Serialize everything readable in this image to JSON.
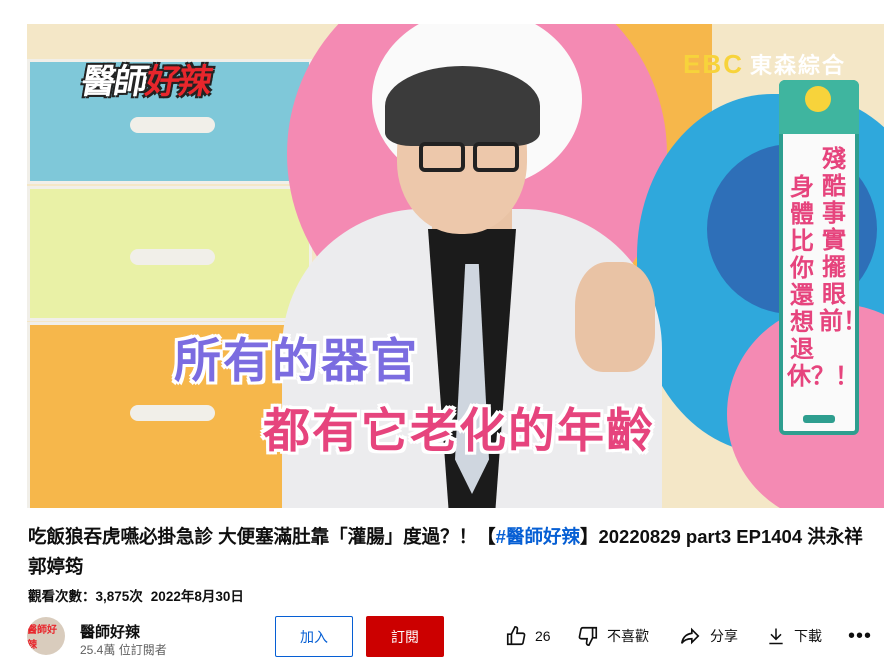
{
  "video": {
    "show_logo_white": "醫師",
    "show_logo_red": "好辣",
    "network_logo_ebc": "EBC",
    "network_logo_text": "東森綜合",
    "caption_line1": "所有的器官",
    "caption_line2": "都有它老化的年齡",
    "side_board_col1": "殘酷事實擺眼前！",
    "side_board_col2": "身體比你還想退休？！"
  },
  "title": {
    "part1": "吃飯狼吞虎嚥必掛急診 大便塞滿肚靠「灌腸」度過？！【",
    "hashtag": "#醫師好辣",
    "part2": "】20220829 part3 EP1404 洪永祥 郭婷筠"
  },
  "meta": {
    "views": "觀看次數：3,875次",
    "date": "2022年8月30日"
  },
  "channel": {
    "avatar_text": "醫師好辣",
    "name": "醫師好辣",
    "subscribers": "25.4萬 位訂閱者"
  },
  "buttons": {
    "join": "加入",
    "subscribe": "訂閱"
  },
  "actions": {
    "like_count": "26",
    "dislike_label": "不喜歡",
    "share_label": "分享",
    "download_label": "下載",
    "more_label": "•••"
  },
  "colors": {
    "subscribe_red": "#cc0000",
    "link_blue": "#065fd4"
  }
}
